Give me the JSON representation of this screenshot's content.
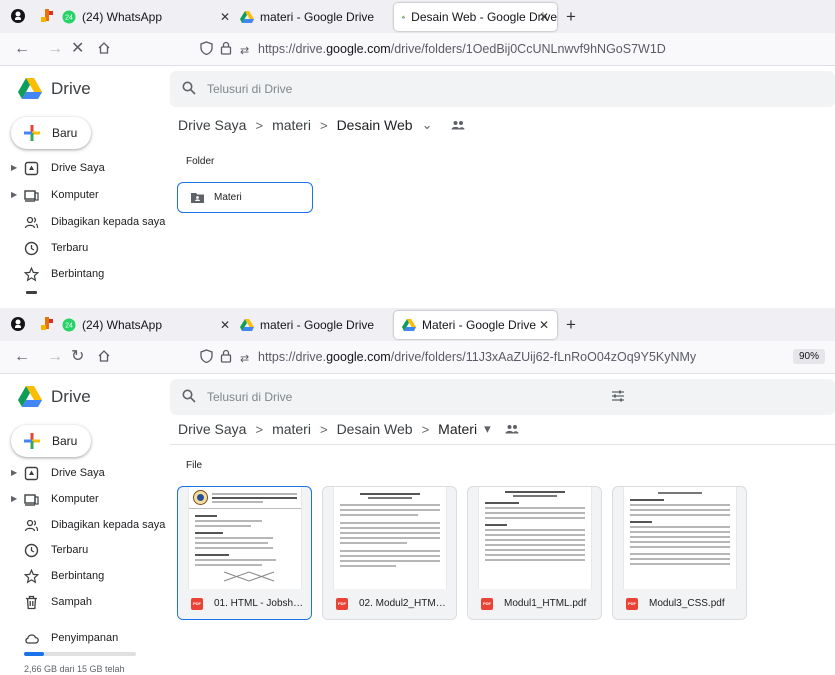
{
  "screens": [
    {
      "tabs": [
        {
          "label": "(24) WhatsApp",
          "badge": "24"
        },
        {
          "label": "materi - Google Drive"
        },
        {
          "label": "Desain Web - Google Drive",
          "active": true
        }
      ],
      "url": {
        "pre": "https://drive.",
        "domain": "google.com",
        "post": "/drive/folders/1OedBij0CcUNLnwvf9hNGoS7W1D"
      },
      "zoom": "",
      "app_title": "Drive",
      "search_placeholder": "Telusuri di Drive",
      "new_button": "Baru",
      "sidebar": [
        {
          "label": "Drive Saya",
          "icon": "drive-icon",
          "caret": true
        },
        {
          "label": "Komputer",
          "icon": "computer-icon",
          "caret": true
        },
        {
          "label": "Dibagikan kepada saya",
          "icon": "shared-icon"
        },
        {
          "label": "Terbaru",
          "icon": "clock-icon"
        },
        {
          "label": "Berbintang",
          "icon": "star-icon"
        }
      ],
      "breadcrumb": [
        "Drive Saya",
        "materi",
        "Desain Web"
      ],
      "section_label": "Folder",
      "folders": [
        {
          "label": "Materi"
        }
      ]
    },
    {
      "tabs": [
        {
          "label": "(24) WhatsApp",
          "badge": "24"
        },
        {
          "label": "materi - Google Drive"
        },
        {
          "label": "Materi - Google Drive",
          "active": true
        }
      ],
      "url": {
        "pre": "https://drive.",
        "domain": "google.com",
        "post": "/drive/folders/11J3xAaZUij62-fLnRoO04zOq9Y5KyNMy"
      },
      "zoom": "90%",
      "app_title": "Drive",
      "search_placeholder": "Telusuri di Drive",
      "new_button": "Baru",
      "sidebar": [
        {
          "label": "Drive Saya",
          "icon": "drive-icon",
          "caret": true
        },
        {
          "label": "Komputer",
          "icon": "computer-icon",
          "caret": true
        },
        {
          "label": "Dibagikan kepada saya",
          "icon": "shared-icon"
        },
        {
          "label": "Terbaru",
          "icon": "clock-icon"
        },
        {
          "label": "Berbintang",
          "icon": "star-icon"
        },
        {
          "label": "Sampah",
          "icon": "trash-icon"
        },
        {
          "label": "Penyimpanan",
          "icon": "cloud-icon"
        }
      ],
      "storage": {
        "text": "2,66 GB dari 15 GB telah",
        "fraction": 0.177
      },
      "breadcrumb": [
        "Drive Saya",
        "materi",
        "Desain Web",
        "Materi"
      ],
      "section_label": "File",
      "files": [
        {
          "name": "01. HTML - Jobsheet....",
          "type": "PDF",
          "selected": true
        },
        {
          "name": "02. Modul2_HTML.pdf",
          "type": "PDF"
        },
        {
          "name": "Modul1_HTML.pdf",
          "type": "PDF"
        },
        {
          "name": "Modul3_CSS.pdf",
          "type": "PDF"
        }
      ]
    }
  ],
  "colors": {
    "accent": "#1a73e8",
    "pdf": "#ea4335",
    "whatsapp": "#25d366"
  }
}
